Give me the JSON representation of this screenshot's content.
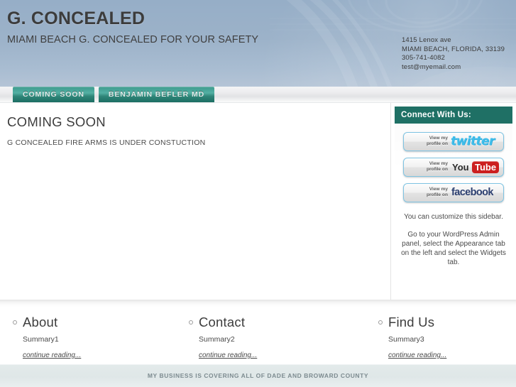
{
  "header": {
    "site_title": "G. CONCEALED",
    "tagline": "MIAMI BEACH G. CONCEALED FOR YOUR SAFETY",
    "contact": {
      "street": "1415 Lenox ave",
      "city_state_zip": "MIAMI BEACH, FLORIDA, 33139",
      "phone": "305-741-4082",
      "email": "test@myemail.com"
    }
  },
  "nav": {
    "items": [
      {
        "label": "COMING SOON",
        "active": true
      },
      {
        "label": "BENJAMIN BEFLER MD",
        "active": false
      }
    ]
  },
  "content": {
    "post_title": "COMING SOON",
    "post_body": "G CONCEALED FIRE ARMS IS UNDER CONSTUCTION"
  },
  "sidebar": {
    "widget_title": "Connect With Us:",
    "badges": [
      {
        "icon": "twitter-icon",
        "lead_line1": "View my",
        "lead_line2": "profile on",
        "brand": "twitter"
      },
      {
        "icon": "youtube-icon",
        "lead_line1": "View my",
        "lead_line2": "profile on",
        "brand_you": "You",
        "brand_tube": "Tube"
      },
      {
        "icon": "facebook-icon",
        "lead_line1": "View my",
        "lead_line2": "profile on",
        "brand": "facebook"
      }
    ],
    "note_1": "You can customize this sidebar.",
    "note_2": "Go to your WordPress Admin panel, select the Appearance tab on the left and select the Widgets tab."
  },
  "footer_columns": [
    {
      "title": "About",
      "summary": "Summary1",
      "more": "continue reading..."
    },
    {
      "title": "Contact",
      "summary": "Summary2",
      "more": "continue reading..."
    },
    {
      "title": "Find Us",
      "summary": "Summary3",
      "more": "continue reading..."
    }
  ],
  "bottom_bar": {
    "text": "MY BUSINESS IS COVERING ALL OF DADE AND BROWARD COUNTY"
  },
  "colors": {
    "header_blue": "#9cb2c9",
    "nav_teal": "#46a497",
    "sidebar_teal": "#1f7065",
    "bottom_bar": "#dfe7e8",
    "text_dark": "#3d3d3d",
    "youtube_red": "#cc1f1f",
    "twitter_blue": "#3fbdea",
    "facebook_navy": "#2c3f70"
  }
}
